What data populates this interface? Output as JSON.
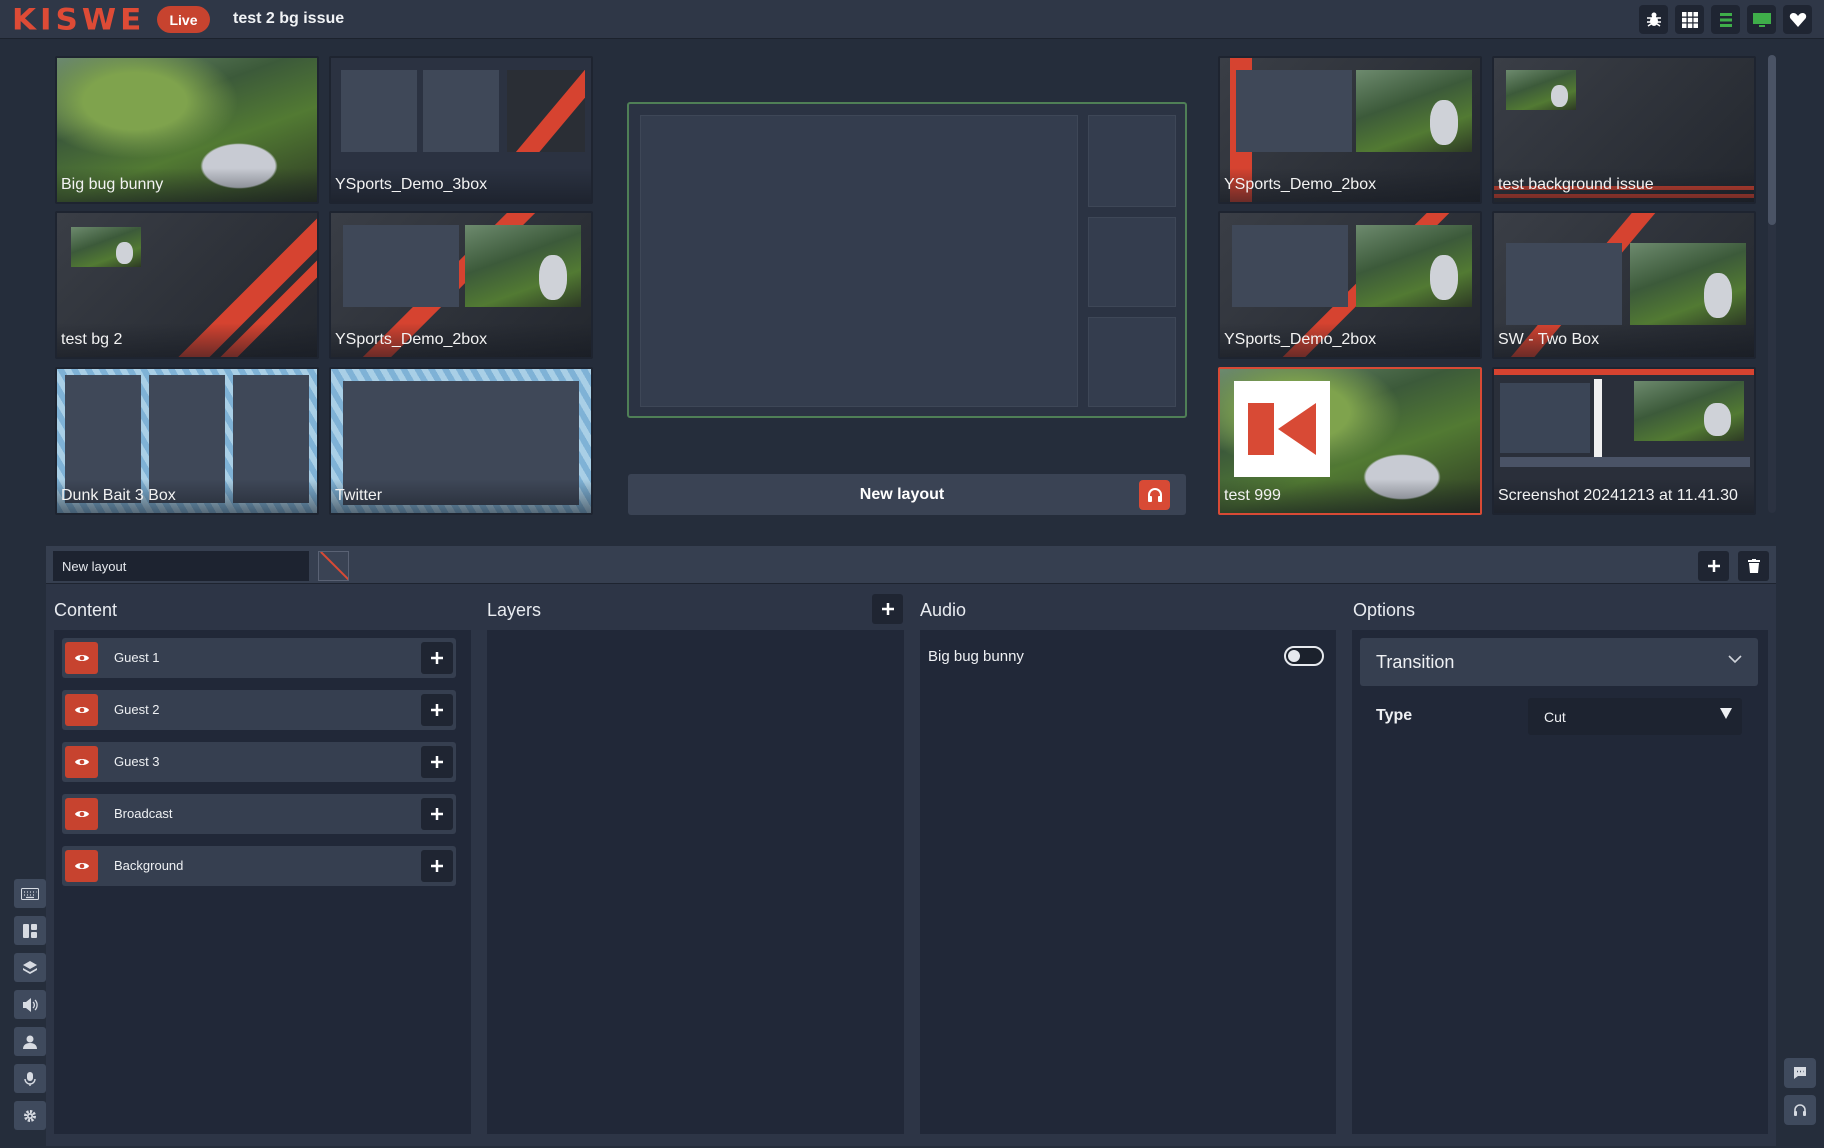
{
  "header": {
    "logo": "KISWE",
    "live_label": "Live",
    "session_title": "test 2 bg issue",
    "icons": [
      "bug-icon",
      "grid-icon",
      "list-icon",
      "monitor-icon",
      "heart-icon"
    ]
  },
  "layouts_left": [
    {
      "name": "Big bug bunny"
    },
    {
      "name": "YSports_Demo_3box"
    },
    {
      "name": "test bg 2"
    },
    {
      "name": "YSports_Demo_2box"
    },
    {
      "name": "Dunk Bait 3 Box"
    },
    {
      "name": "Twitter"
    }
  ],
  "layouts_right": [
    {
      "name": "YSports_Demo_2box"
    },
    {
      "name": "test background issue"
    },
    {
      "name": "YSports_Demo_2box"
    },
    {
      "name": "SW - Two Box"
    },
    {
      "name": "test 999"
    },
    {
      "name": "Screenshot 20241213 at 11.41.30"
    }
  ],
  "preview": {
    "layout_name": "New layout"
  },
  "editor": {
    "layout_name_value": "New layout",
    "content_title": "Content",
    "layers_title": "Layers",
    "audio_title": "Audio",
    "options_title": "Options",
    "content_items": [
      {
        "label": "Guest 1"
      },
      {
        "label": "Guest 2"
      },
      {
        "label": "Guest 3"
      },
      {
        "label": "Broadcast"
      },
      {
        "label": "Background"
      }
    ],
    "audio_items": [
      {
        "label": "Big bug bunny",
        "enabled": false
      }
    ],
    "options": {
      "section": "Transition",
      "type_label": "Type",
      "type_value": "Cut"
    }
  },
  "side_nav": [
    "keyboard-icon",
    "layout-icon",
    "layers-icon",
    "speaker-icon",
    "user-icon",
    "microphone-icon",
    "gear-icon"
  ],
  "colors": {
    "accent": "#d84a35",
    "live": "#c7432f",
    "preview_border": "#4f7f56",
    "background": "#252d3b"
  }
}
